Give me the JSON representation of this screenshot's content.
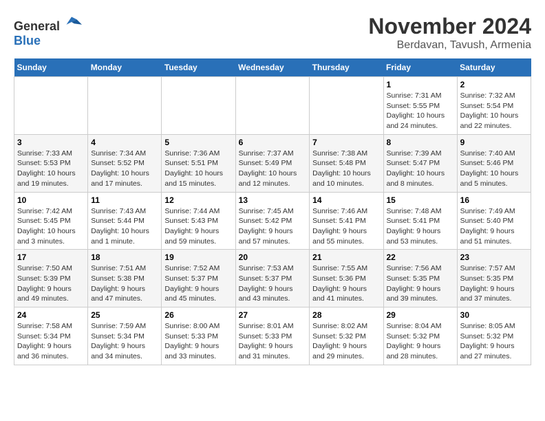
{
  "logo": {
    "general": "General",
    "blue": "Blue"
  },
  "title": "November 2024",
  "subtitle": "Berdavan, Tavush, Armenia",
  "weekdays": [
    "Sunday",
    "Monday",
    "Tuesday",
    "Wednesday",
    "Thursday",
    "Friday",
    "Saturday"
  ],
  "weeks": [
    [
      {
        "day": "",
        "info": ""
      },
      {
        "day": "",
        "info": ""
      },
      {
        "day": "",
        "info": ""
      },
      {
        "day": "",
        "info": ""
      },
      {
        "day": "",
        "info": ""
      },
      {
        "day": "1",
        "info": "Sunrise: 7:31 AM\nSunset: 5:55 PM\nDaylight: 10 hours and 24 minutes."
      },
      {
        "day": "2",
        "info": "Sunrise: 7:32 AM\nSunset: 5:54 PM\nDaylight: 10 hours and 22 minutes."
      }
    ],
    [
      {
        "day": "3",
        "info": "Sunrise: 7:33 AM\nSunset: 5:53 PM\nDaylight: 10 hours and 19 minutes."
      },
      {
        "day": "4",
        "info": "Sunrise: 7:34 AM\nSunset: 5:52 PM\nDaylight: 10 hours and 17 minutes."
      },
      {
        "day": "5",
        "info": "Sunrise: 7:36 AM\nSunset: 5:51 PM\nDaylight: 10 hours and 15 minutes."
      },
      {
        "day": "6",
        "info": "Sunrise: 7:37 AM\nSunset: 5:49 PM\nDaylight: 10 hours and 12 minutes."
      },
      {
        "day": "7",
        "info": "Sunrise: 7:38 AM\nSunset: 5:48 PM\nDaylight: 10 hours and 10 minutes."
      },
      {
        "day": "8",
        "info": "Sunrise: 7:39 AM\nSunset: 5:47 PM\nDaylight: 10 hours and 8 minutes."
      },
      {
        "day": "9",
        "info": "Sunrise: 7:40 AM\nSunset: 5:46 PM\nDaylight: 10 hours and 5 minutes."
      }
    ],
    [
      {
        "day": "10",
        "info": "Sunrise: 7:42 AM\nSunset: 5:45 PM\nDaylight: 10 hours and 3 minutes."
      },
      {
        "day": "11",
        "info": "Sunrise: 7:43 AM\nSunset: 5:44 PM\nDaylight: 10 hours and 1 minute."
      },
      {
        "day": "12",
        "info": "Sunrise: 7:44 AM\nSunset: 5:43 PM\nDaylight: 9 hours and 59 minutes."
      },
      {
        "day": "13",
        "info": "Sunrise: 7:45 AM\nSunset: 5:42 PM\nDaylight: 9 hours and 57 minutes."
      },
      {
        "day": "14",
        "info": "Sunrise: 7:46 AM\nSunset: 5:41 PM\nDaylight: 9 hours and 55 minutes."
      },
      {
        "day": "15",
        "info": "Sunrise: 7:48 AM\nSunset: 5:41 PM\nDaylight: 9 hours and 53 minutes."
      },
      {
        "day": "16",
        "info": "Sunrise: 7:49 AM\nSunset: 5:40 PM\nDaylight: 9 hours and 51 minutes."
      }
    ],
    [
      {
        "day": "17",
        "info": "Sunrise: 7:50 AM\nSunset: 5:39 PM\nDaylight: 9 hours and 49 minutes."
      },
      {
        "day": "18",
        "info": "Sunrise: 7:51 AM\nSunset: 5:38 PM\nDaylight: 9 hours and 47 minutes."
      },
      {
        "day": "19",
        "info": "Sunrise: 7:52 AM\nSunset: 5:37 PM\nDaylight: 9 hours and 45 minutes."
      },
      {
        "day": "20",
        "info": "Sunrise: 7:53 AM\nSunset: 5:37 PM\nDaylight: 9 hours and 43 minutes."
      },
      {
        "day": "21",
        "info": "Sunrise: 7:55 AM\nSunset: 5:36 PM\nDaylight: 9 hours and 41 minutes."
      },
      {
        "day": "22",
        "info": "Sunrise: 7:56 AM\nSunset: 5:35 PM\nDaylight: 9 hours and 39 minutes."
      },
      {
        "day": "23",
        "info": "Sunrise: 7:57 AM\nSunset: 5:35 PM\nDaylight: 9 hours and 37 minutes."
      }
    ],
    [
      {
        "day": "24",
        "info": "Sunrise: 7:58 AM\nSunset: 5:34 PM\nDaylight: 9 hours and 36 minutes."
      },
      {
        "day": "25",
        "info": "Sunrise: 7:59 AM\nSunset: 5:34 PM\nDaylight: 9 hours and 34 minutes."
      },
      {
        "day": "26",
        "info": "Sunrise: 8:00 AM\nSunset: 5:33 PM\nDaylight: 9 hours and 33 minutes."
      },
      {
        "day": "27",
        "info": "Sunrise: 8:01 AM\nSunset: 5:33 PM\nDaylight: 9 hours and 31 minutes."
      },
      {
        "day": "28",
        "info": "Sunrise: 8:02 AM\nSunset: 5:32 PM\nDaylight: 9 hours and 29 minutes."
      },
      {
        "day": "29",
        "info": "Sunrise: 8:04 AM\nSunset: 5:32 PM\nDaylight: 9 hours and 28 minutes."
      },
      {
        "day": "30",
        "info": "Sunrise: 8:05 AM\nSunset: 5:32 PM\nDaylight: 9 hours and 27 minutes."
      }
    ]
  ]
}
